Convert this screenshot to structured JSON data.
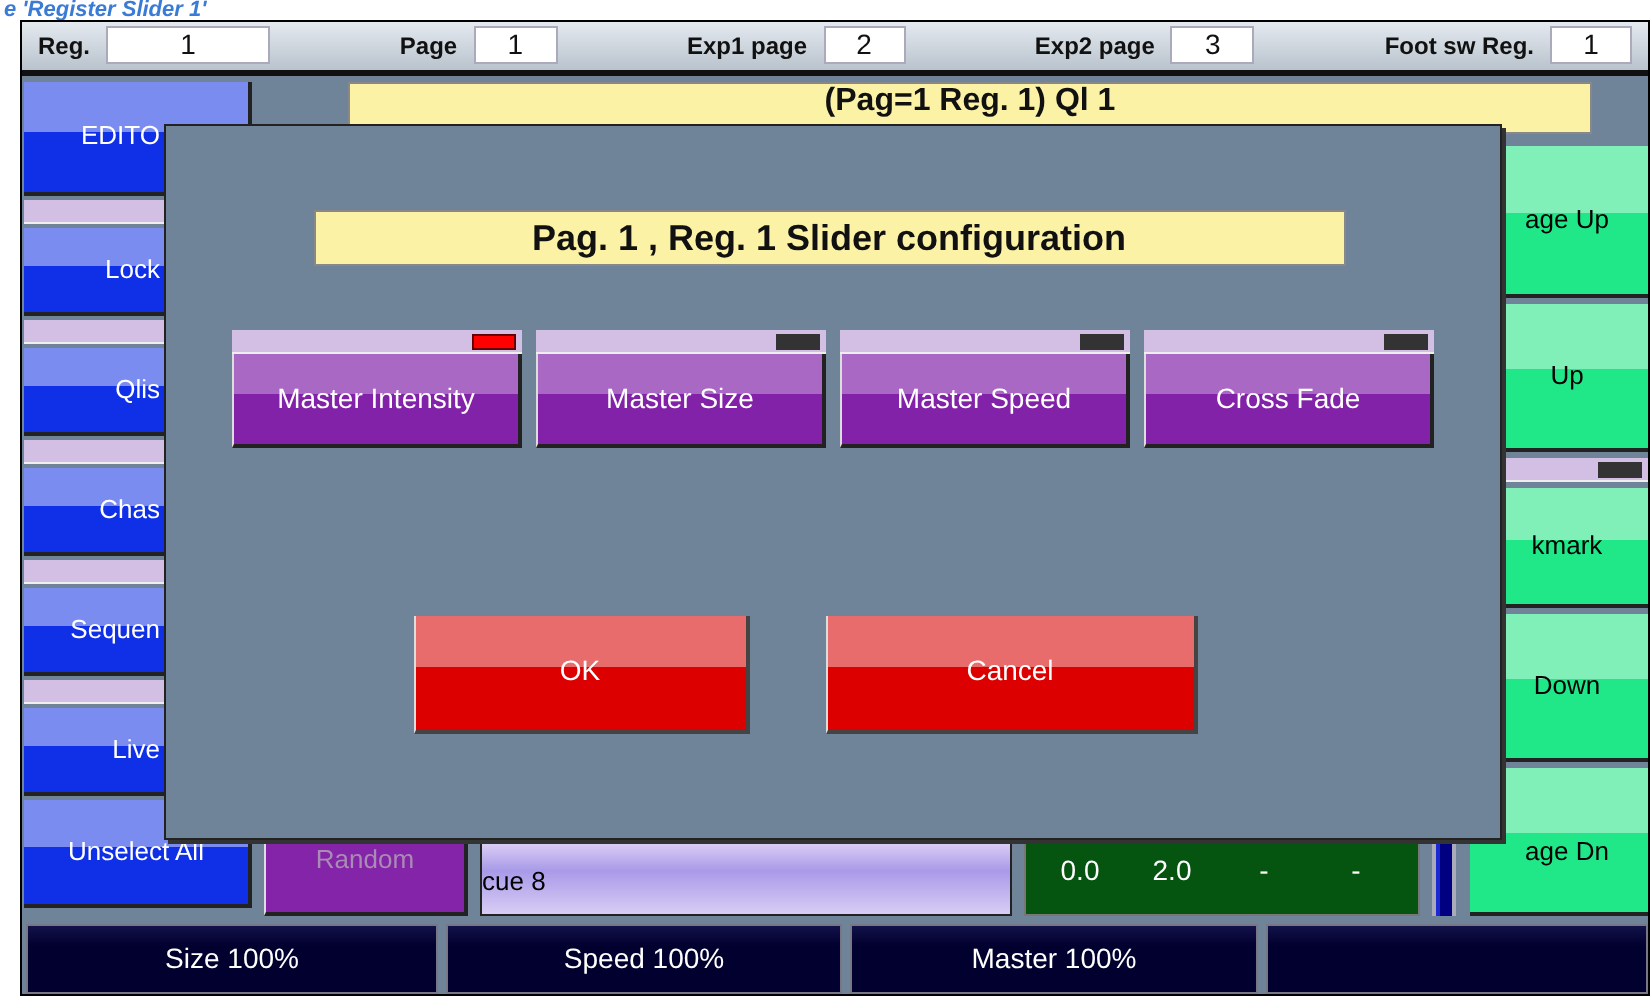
{
  "window": {
    "caption": "e 'Register Slider 1'"
  },
  "header_fields": [
    {
      "label": "Reg.",
      "value": "1"
    },
    {
      "label": "Page",
      "value": "1"
    },
    {
      "label": "Exp1 page",
      "value": "2"
    },
    {
      "label": "Exp2 page",
      "value": "3"
    },
    {
      "label": "Foot sw Reg.",
      "value": "1"
    }
  ],
  "title_bar": "(Pag=1 Reg. 1) Ql 1",
  "left_buttons": [
    {
      "label": "EDITO",
      "stripe": false,
      "covered": true
    },
    {
      "label": "Lock",
      "stripe": true,
      "covered": true
    },
    {
      "label": "Qlis",
      "stripe": true,
      "covered": true
    },
    {
      "label": "Chas",
      "stripe": true,
      "covered": true
    },
    {
      "label": "Sequen",
      "stripe": true,
      "covered": true
    },
    {
      "label": "Live",
      "stripe": true,
      "covered": true
    },
    {
      "label": "Unselect All",
      "stripe": false,
      "covered": false
    }
  ],
  "right_buttons": [
    {
      "label": "age Up",
      "stripe": false
    },
    {
      "label": "Up",
      "stripe": false
    },
    {
      "label": "kmark",
      "stripe": true
    },
    {
      "label": "Down",
      "stripe": false
    },
    {
      "label": "age Dn",
      "stripe": false
    }
  ],
  "bottom_row": {
    "random": {
      "label": "Random",
      "disabled": true
    },
    "cue": "cue 8",
    "timings": [
      "0.0",
      "2.0",
      "-",
      "-"
    ]
  },
  "status_bar": [
    "Size 100%",
    "Speed 100%",
    "Master 100%"
  ],
  "dialog": {
    "title": "Pag. 1 , Reg. 1   Slider configuration",
    "options": [
      {
        "label": "Master Intensity",
        "selected": true
      },
      {
        "label": "Master Size",
        "selected": false
      },
      {
        "label": "Master Speed",
        "selected": false
      },
      {
        "label": "Cross Fade",
        "selected": false
      }
    ],
    "buttons": [
      "OK",
      "Cancel"
    ]
  }
}
